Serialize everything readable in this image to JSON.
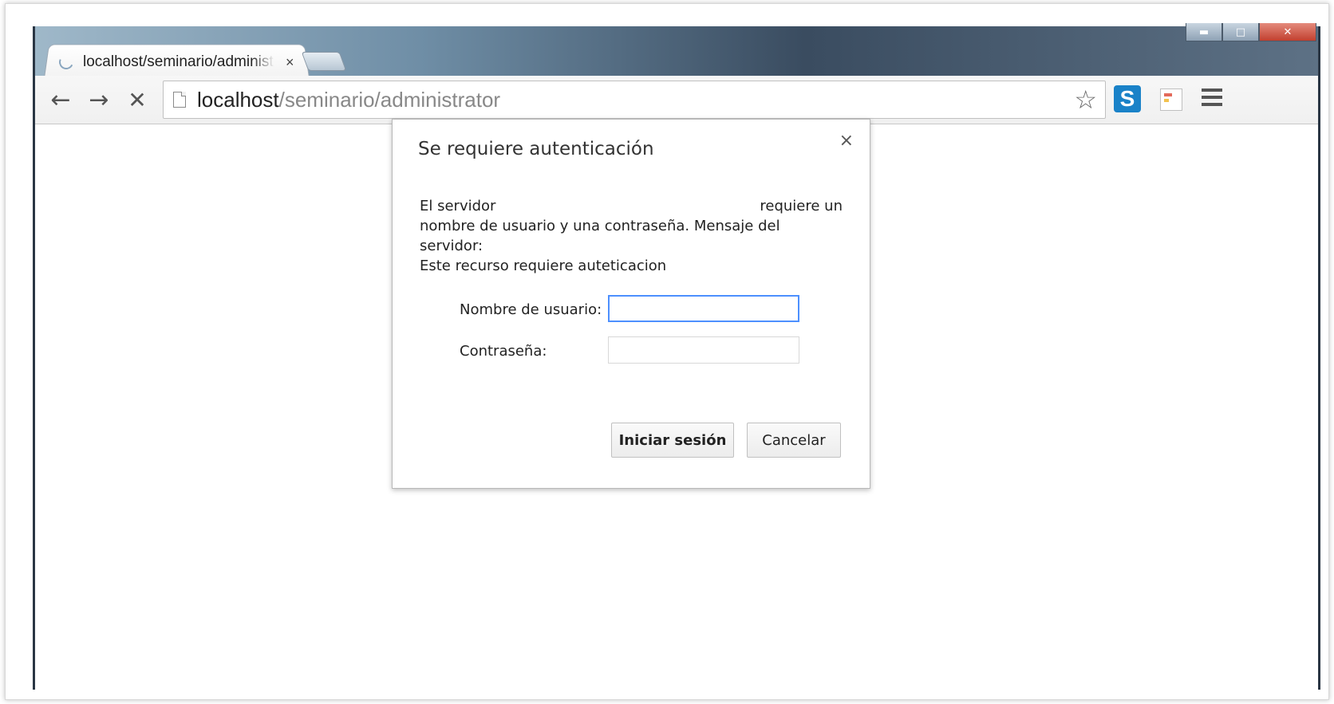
{
  "browser": {
    "tab": {
      "title": "localhost/seminario/administrator",
      "close_glyph": "×"
    },
    "nav": {
      "back_glyph": "←",
      "forward_glyph": "→",
      "stop_glyph": "✕"
    },
    "url": {
      "host": "localhost",
      "path": "/seminario/administrator"
    },
    "icons": {
      "star": "star-icon",
      "extension_s_letter": "S",
      "calendar": "calendar-icon",
      "menu": "menu-icon"
    },
    "window_controls": {
      "minimize_glyph": "▬",
      "maximize_glyph": "□",
      "close_glyph": "✕"
    }
  },
  "dialog": {
    "title": "Se requiere autenticación",
    "close_glyph": "×",
    "message_line1_left": "El servidor",
    "message_line1_right": "requiere un",
    "message_line2": "nombre de usuario y una contraseña. Mensaje del servidor:",
    "message_line3": "Este recurso requiere auteticacion",
    "username_label": "Nombre de usuario:",
    "username_value": "",
    "password_label": "Contraseña:",
    "password_value": "",
    "login_button": "Iniciar sesión",
    "cancel_button": "Cancelar"
  }
}
